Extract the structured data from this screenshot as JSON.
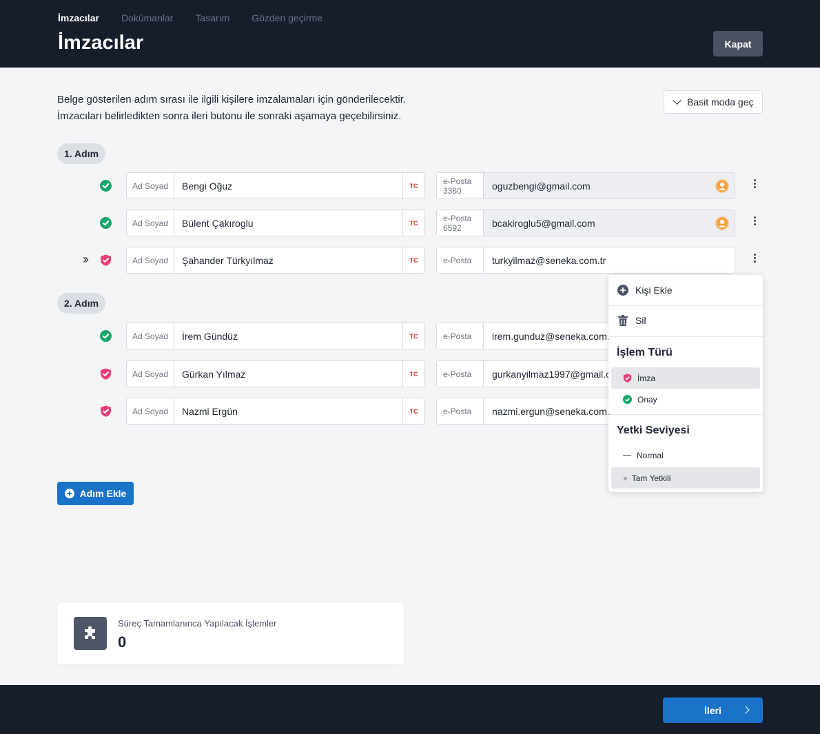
{
  "header": {
    "tabs": [
      {
        "label": "İmzacılar",
        "active": true
      },
      {
        "label": "Dokümanlar",
        "active": false
      },
      {
        "label": "Tasarım",
        "active": false
      },
      {
        "label": "Gözden geçirme",
        "active": false
      }
    ],
    "title": "İmzacılar",
    "close_label": "Kapat"
  },
  "description": {
    "line1": "Belge gösterilen adım sırası ile ilgili kişilere imzalamaları için gönderilecektir.",
    "line2": "İmzacıları belirledikten sonra ileri butonu ile sonraki aşamaya geçebilirsiniz."
  },
  "simple_mode_label": "Basit moda geç",
  "steps": [
    {
      "label": "1. Adım",
      "signers": [
        {
          "name_label": "Ad Soyad",
          "name": "Bengi Oğuz",
          "tc": "TC",
          "email_label": "e-Posta",
          "email_code": "3360",
          "email": "oguzbengi@gmail.com",
          "type": "approve",
          "verified": true
        },
        {
          "name_label": "Ad Soyad",
          "name": "Bülent Çakıroglu",
          "tc": "TC",
          "email_label": "e-Posta",
          "email_code": "6592",
          "email": "bcakiroglu5@gmail.com",
          "type": "approve",
          "verified": true
        },
        {
          "name_label": "Ad Soyad",
          "name": "Şahander Türkyılmaz",
          "tc": "TC",
          "email_label": "e-Posta",
          "email_code": "",
          "email": "turkyilmaz@seneka.com.tr",
          "type": "sign",
          "full_authority": true
        }
      ]
    },
    {
      "label": "2. Adım",
      "signers": [
        {
          "name_label": "Ad Soyad",
          "name": "İrem Gündüz",
          "tc": "TC",
          "email_label": "e-Posta",
          "email_code": "",
          "email": "irem.gunduz@seneka.com.tr",
          "type": "approve"
        },
        {
          "name_label": "Ad Soyad",
          "name": "Gürkan Yılmaz",
          "tc": "TC",
          "email_label": "e-Posta",
          "email_code": "",
          "email": "gurkanyilmaz1997@gmail.com",
          "type": "sign"
        },
        {
          "name_label": "Ad Soyad",
          "name": "Nazmi Ergün",
          "tc": "TC",
          "email_label": "e-Posta",
          "email_code": "",
          "email": "nazmi.ergun@seneka.com.tr",
          "type": "sign"
        }
      ]
    }
  ],
  "menu": {
    "add_person": "Kişi Ekle",
    "delete": "Sil",
    "type_heading": "İşlem Türü",
    "type_sign": "İmza",
    "type_approve": "Onay",
    "authority_heading": "Yetki Seviyesi",
    "authority_normal": "Normal",
    "authority_full": "Tam Yetkili"
  },
  "add_step_label": "Adım Ekle",
  "completion": {
    "label": "Süreç Tamamlanınca Yapılacak İşlemler",
    "count": "0"
  },
  "next_label": "İleri",
  "colors": {
    "header_bg": "#161d2b",
    "primary": "#1a73c8",
    "approve_green": "#1aa56b",
    "sign_pink": "#e8407a",
    "tc_red": "#c0392b",
    "verified_orange": "#f5a341"
  }
}
